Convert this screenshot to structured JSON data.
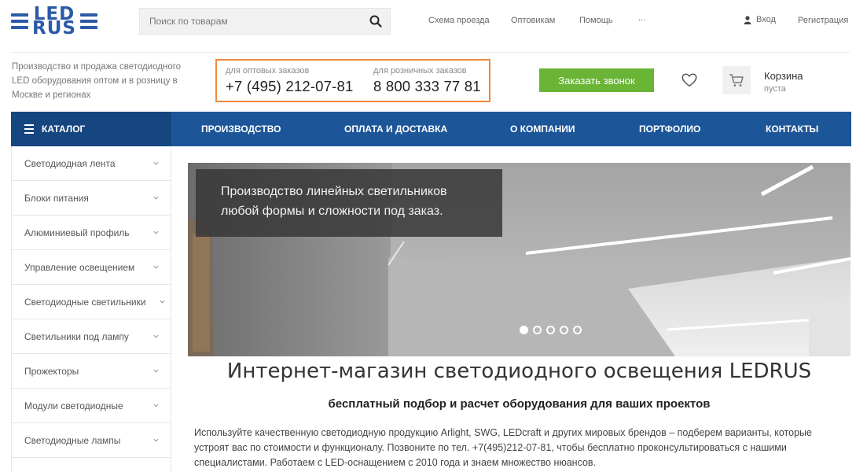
{
  "header": {
    "logo": {
      "line1": "LED",
      "line2": "RUS"
    },
    "search": {
      "placeholder": "Поиск по товарам",
      "value": ""
    },
    "top_links": [
      "Схема проезда",
      "Оптовикам",
      "Помощь",
      "..."
    ],
    "login_label": "Вход",
    "register_label": "Регистрация",
    "tagline": "Производство и продажа светодиодного LED оборудования оптом и в розницу в Москве и регионах",
    "phones": {
      "wholesale": {
        "caption": "для оптовых заказов",
        "number": "+7 (495) 212-07-81"
      },
      "retail": {
        "caption": "для розничных заказов",
        "number": "8 800 333 77 81"
      }
    },
    "callback_label": "Заказать звонок",
    "cart": {
      "title": "Корзина",
      "status": "пуста"
    }
  },
  "nav": {
    "catalog_label": "КАТАЛОГ",
    "items": [
      "ПРОИЗВОДСТВО",
      "ОПЛАТА И ДОСТАВКА",
      "О КОМПАНИИ",
      "ПОРТФОЛИО",
      "КОНТАКТЫ"
    ]
  },
  "sidebar": {
    "items": [
      "Светодиодная лента",
      "Блоки питания",
      "Алюминиевый профиль",
      "Управление освещением",
      "Светодиодные светильники",
      "Светильники под лампу",
      "Прожекторы",
      "Модули светодиодные",
      "Светодиодные лампы"
    ]
  },
  "hero": {
    "caption_line1": "Производство линейных светильников",
    "caption_line2": "любой формы и сложности под заказ.",
    "slides_count": 5,
    "active_slide": 1
  },
  "content": {
    "title": "Интернет-магазин светодиодного освещения LEDRUS",
    "subtitle": "бесплатный подбор и расчет оборудования для ваших проектов",
    "paragraph": "Используйте качественную светодиодную продукцию Arlight, SWG, LEDcraft и других мировых брендов – подберем варианты, которые устроят вас по стоимости и функционалу. Позвоните по тел. +7(495)212-07-81, чтобы бесплатно проконсультироваться с нашими специалистами. Работаем с LED-оснащением с 2010 года и знаем множество нюансов."
  },
  "colors": {
    "brand_blue": "#1c5699",
    "catalog_blue": "#16467f",
    "logo_blue": "#2b5aa7",
    "callback_green": "#6ab536",
    "phone_box_border": "#f08a3c"
  },
  "icons": {
    "search": "search-icon",
    "user": "user-icon",
    "favorite": "heart-icon",
    "cart": "cart-icon",
    "menu": "menu-icon",
    "chevron": "chevron-down-icon"
  }
}
